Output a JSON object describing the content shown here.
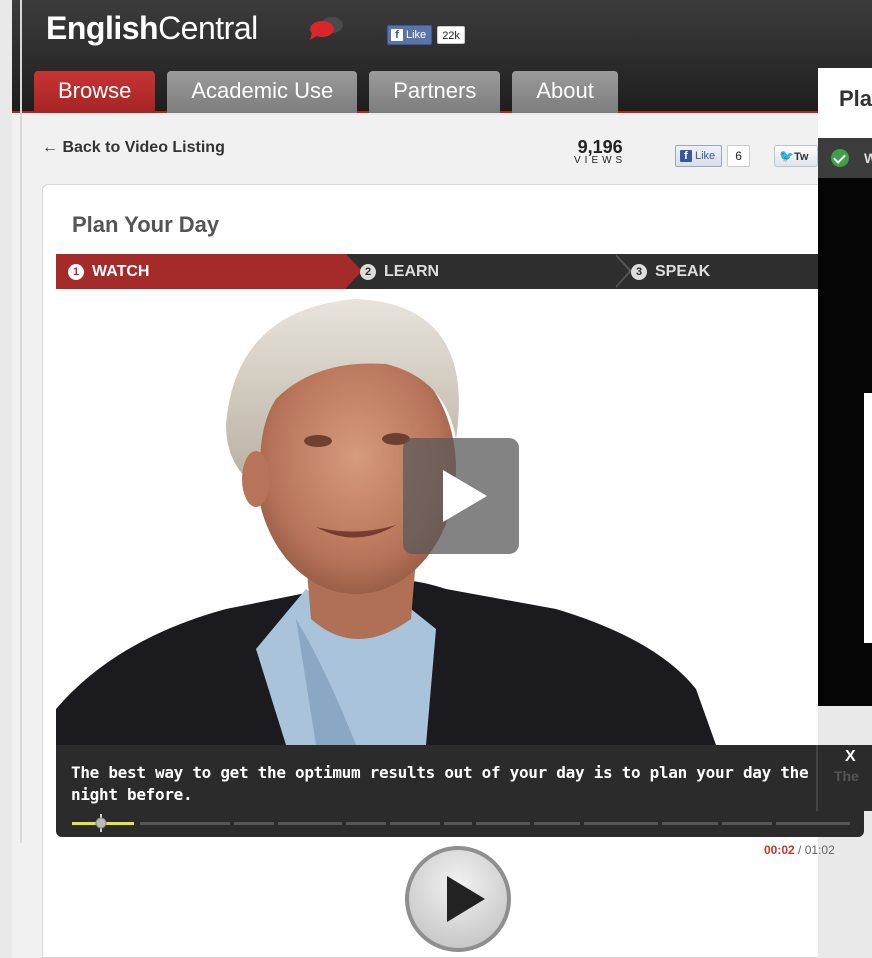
{
  "header": {
    "logo_bold": "English",
    "logo_light": "Central",
    "fb_like_label": "Like",
    "fb_like_count": "22k",
    "tabs": [
      {
        "label": "Browse",
        "active": true
      },
      {
        "label": "Academic Use",
        "active": false
      },
      {
        "label": "Partners",
        "active": false
      },
      {
        "label": "About",
        "active": false
      }
    ],
    "right_panel_title": "Pla"
  },
  "subheader": {
    "back_link": "← Back to Video Listing",
    "views_count": "9,196",
    "views_label": "VIEWS",
    "fb_like_label": "Like",
    "fb_like_count": "6",
    "tweet_label": "Tw"
  },
  "video": {
    "title": "Plan Your Day",
    "steps": [
      {
        "num": "1",
        "label": "WATCH",
        "active": true
      },
      {
        "num": "2",
        "label": "LEARN",
        "active": false
      },
      {
        "num": "3",
        "label": "SPEAK",
        "active": false
      }
    ],
    "caption": "The best way to get the optimum results out of your day is to plan your day the night before.",
    "close_label": "X",
    "ghost_caption": "The",
    "time_current": "00:02",
    "time_total": "/ 01:02",
    "progress_fraction": 0.032
  },
  "side_panel": {
    "letter": "W"
  },
  "colors": {
    "accent": "#a52a2a",
    "progress": "#e6e63a",
    "facebook": "#3b5998",
    "twitter": "#2aa6e8",
    "check": "#3ea14a"
  },
  "icons": [
    "speech-bubble-logo-icon",
    "facebook-f-icon",
    "twitter-bird-icon",
    "back-arrow-icon",
    "play-icon",
    "check-circle-icon",
    "close-icon"
  ]
}
